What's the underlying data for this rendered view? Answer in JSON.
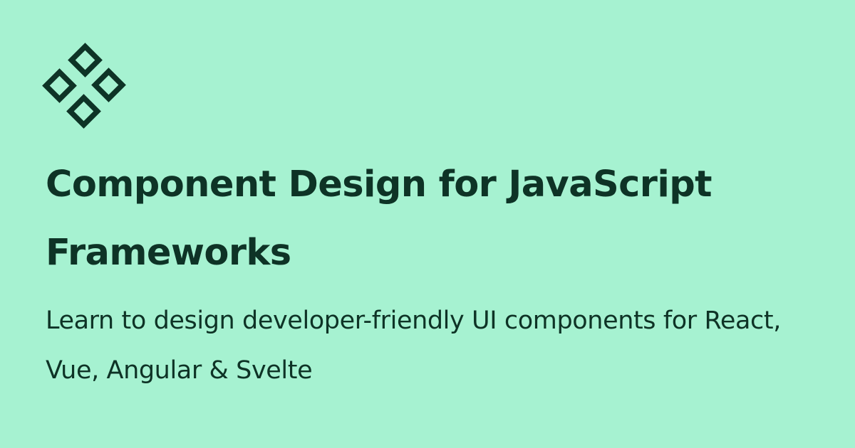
{
  "colors": {
    "background": "#a6f2d1",
    "foreground": "#0e3326"
  },
  "logo": {
    "icon": "four-diamonds-logo-icon"
  },
  "title": "Component Design for JavaScript Frameworks",
  "subtitle": "Learn to design developer-friendly UI components for React, Vue, Angular & Svelte"
}
